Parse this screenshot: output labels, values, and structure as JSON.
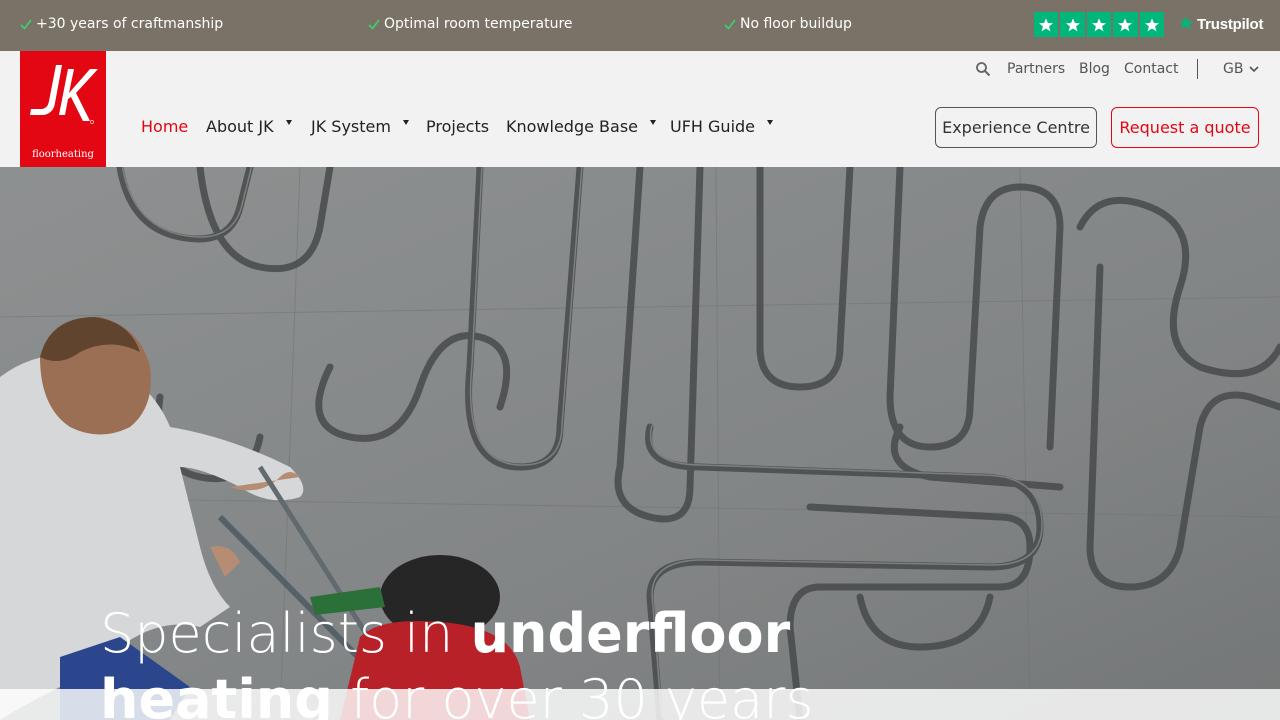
{
  "topbar": {
    "usps": [
      "+30 years of craftmanship",
      "Optimal room temperature",
      "No floor buildup"
    ],
    "trustpilot": {
      "brand": "Trustpilot",
      "stars": 5,
      "star_color": "#00b67a"
    },
    "bg_color": "#7a7266"
  },
  "logo": {
    "subtitle": "floorheating",
    "color": "#e30613"
  },
  "utility_nav": {
    "search_icon": "search-icon",
    "links": [
      "Partners",
      "Blog",
      "Contact"
    ],
    "language": "GB"
  },
  "main_nav": {
    "items": [
      {
        "label": "Home",
        "active": true,
        "dropdown": false
      },
      {
        "label": "About JK",
        "active": false,
        "dropdown": true
      },
      {
        "label": "JK System",
        "active": false,
        "dropdown": true
      },
      {
        "label": "Projects",
        "active": false,
        "dropdown": false
      },
      {
        "label": "Knowledge Base",
        "active": false,
        "dropdown": true
      },
      {
        "label": "UFH Guide",
        "active": false,
        "dropdown": true
      }
    ],
    "active_color": "#e30613"
  },
  "cta": {
    "experience": "Experience Centre",
    "quote": "Request a quote"
  },
  "hero": {
    "title_part1": "Specialists in ",
    "title_bold1": "underfloor",
    "title_bold2": "heating",
    "title_part2": " for over 30 years"
  }
}
